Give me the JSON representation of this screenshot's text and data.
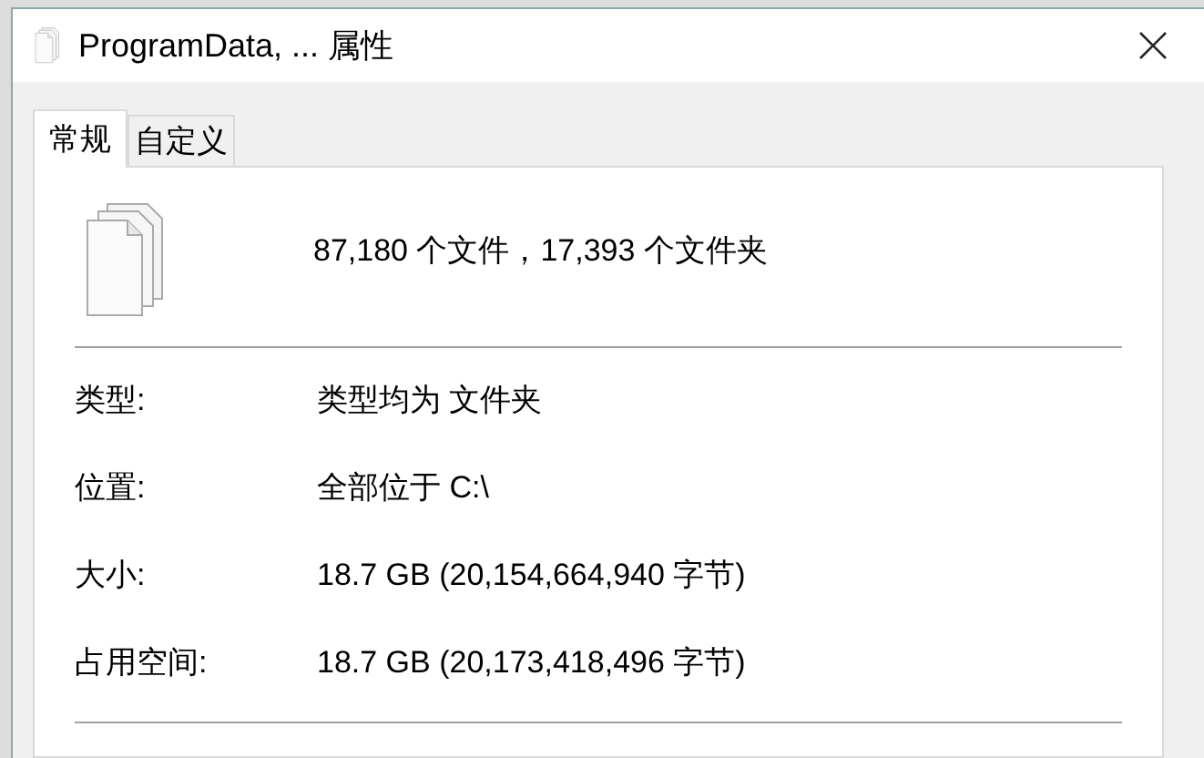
{
  "window": {
    "title": "ProgramData, ... 属性"
  },
  "tabs": [
    {
      "label": "常规",
      "selected": true
    },
    {
      "label": "自定义",
      "selected": false
    }
  ],
  "summary": "87,180 个文件，17,393 个文件夹",
  "properties": [
    {
      "label": "类型:",
      "value": "类型均为 文件夹"
    },
    {
      "label": "位置:",
      "value": "全部位于 C:\\"
    },
    {
      "label": "大小:",
      "value": "18.7 GB (20,154,664,940 字节)"
    },
    {
      "label": "占用空间:",
      "value": "18.7 GB (20,173,418,496 字节)"
    }
  ]
}
